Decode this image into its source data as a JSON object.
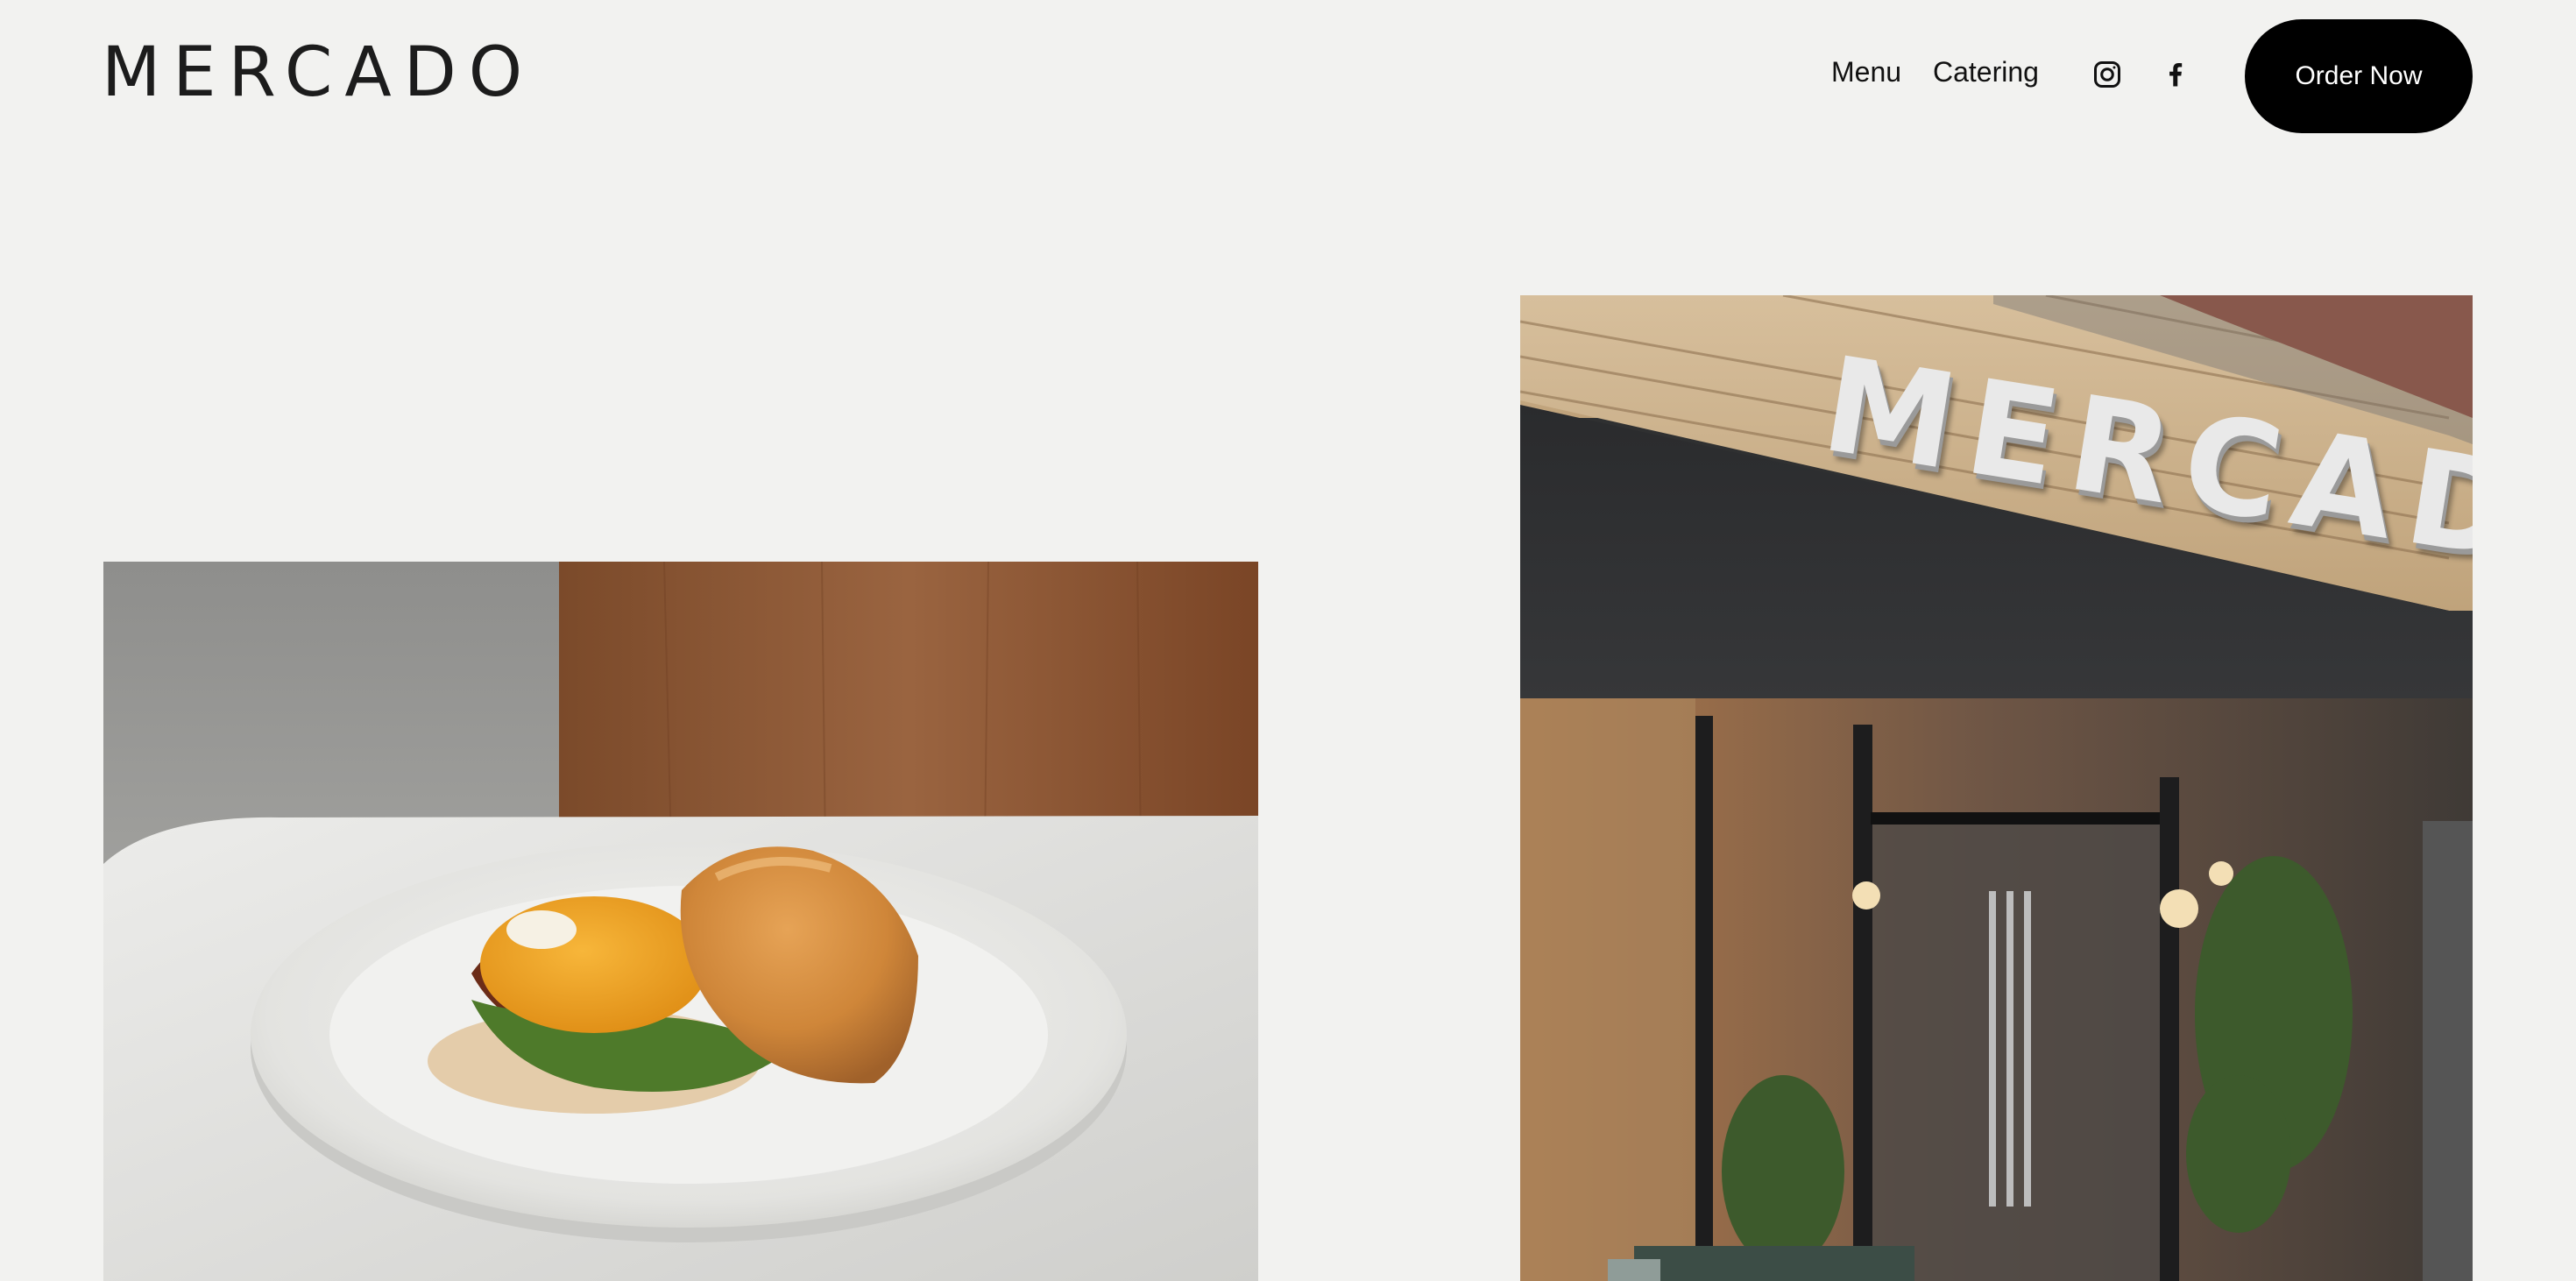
{
  "header": {
    "logo_text": "MERCADO",
    "nav": {
      "menu_label": "Menu",
      "catering_label": "Catering"
    },
    "social": {
      "instagram_icon": "instagram-icon",
      "facebook_icon": "facebook-icon"
    },
    "order_button_label": "Order Now"
  },
  "gallery": {
    "food_photo": "sandwich-plate-photo",
    "storefront_photo": "storefront-photo",
    "storefront_sign_text": "MERCADO"
  },
  "colors": {
    "background": "#f2f2f0",
    "button": "#000000",
    "button_text": "#ffffff",
    "text": "#111111"
  }
}
